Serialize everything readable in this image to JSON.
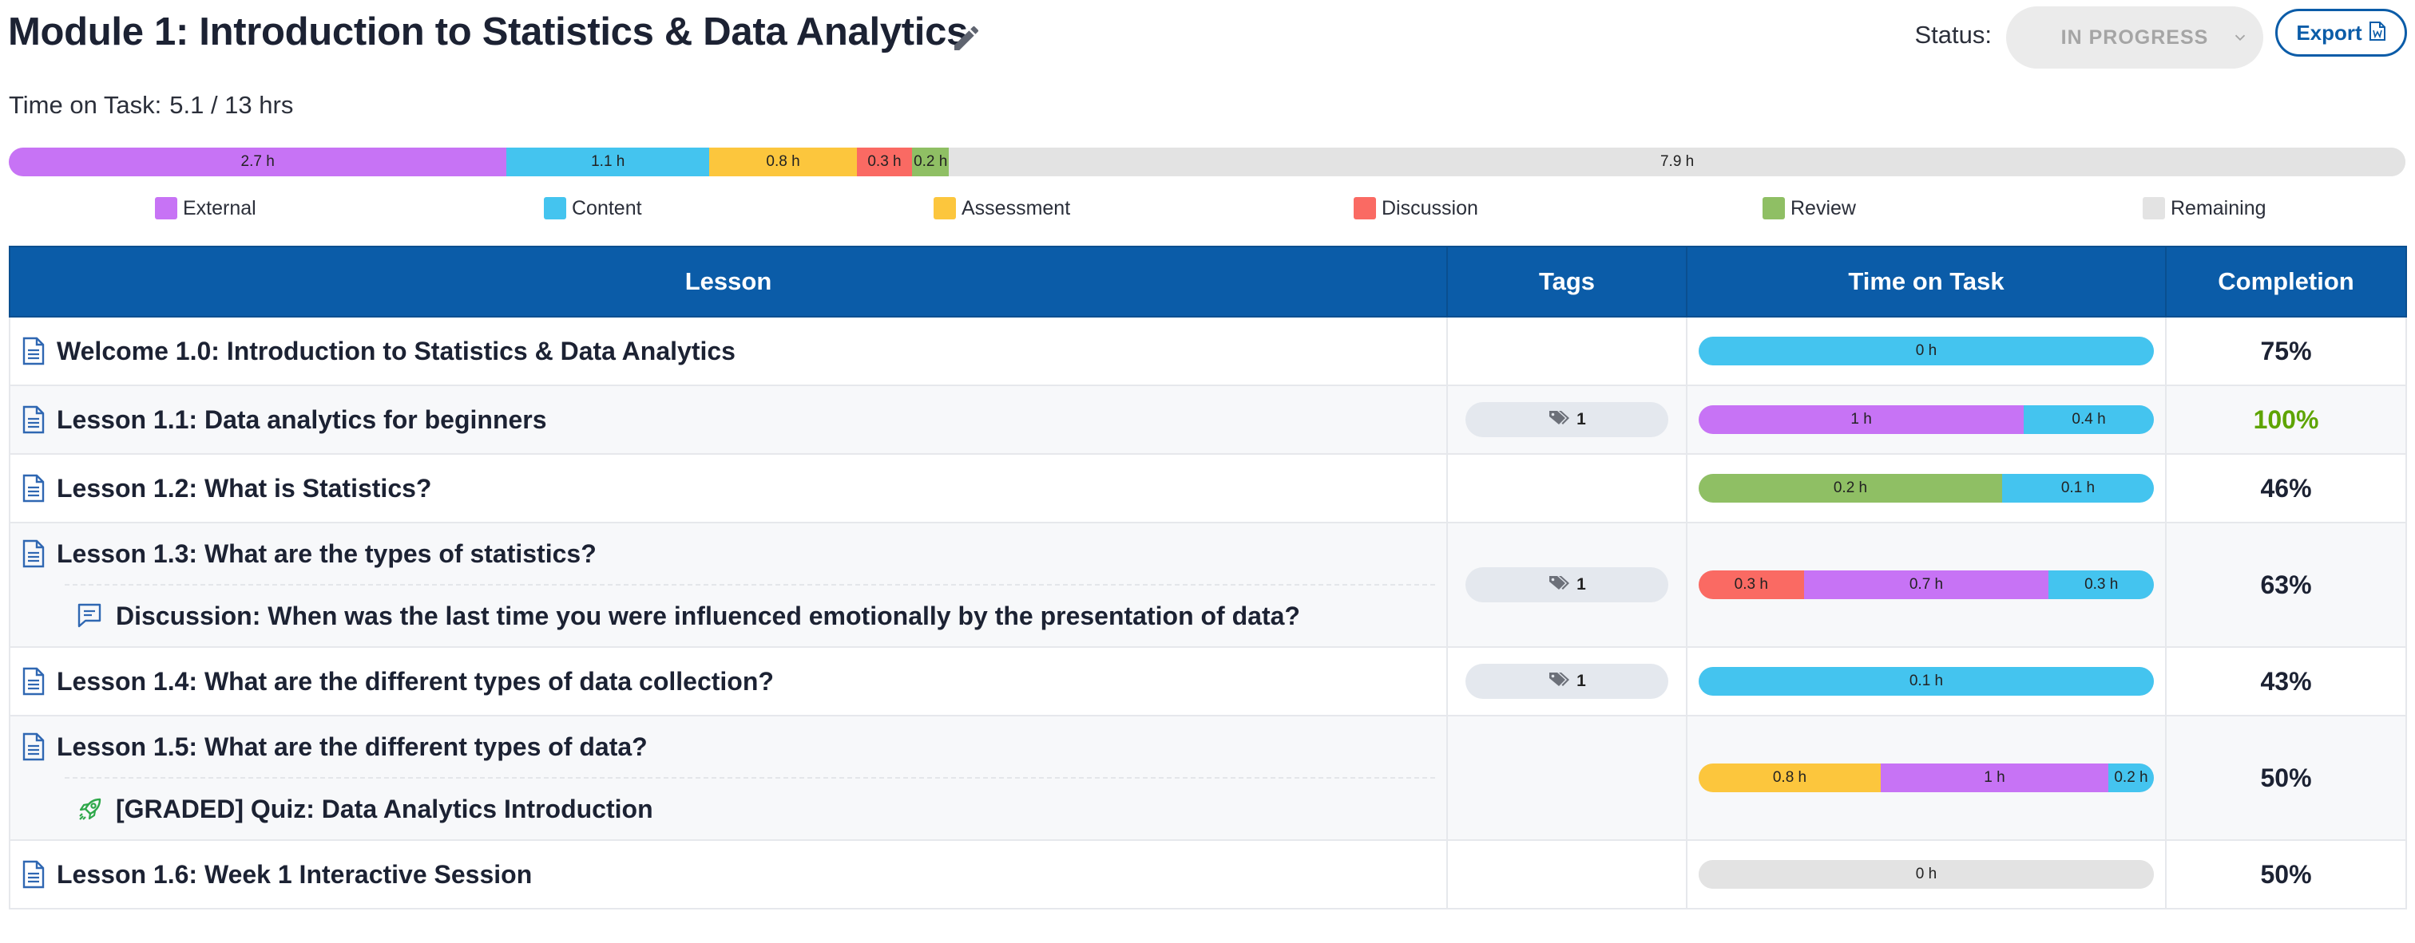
{
  "header": {
    "title": "Module 1: Introduction to Statistics & Data Analytics",
    "status_label": "Status:",
    "status_value": "IN PROGRESS",
    "export_label": "Export"
  },
  "time_on_task": {
    "label": "Time on Task:",
    "value": "5.1 / 13 hrs",
    "segments": [
      {
        "category": "External",
        "hours": 2.7,
        "label": "2.7 h"
      },
      {
        "category": "Content",
        "hours": 1.1,
        "label": "1.1 h"
      },
      {
        "category": "Assessment",
        "hours": 0.8,
        "label": "0.8 h"
      },
      {
        "category": "Discussion",
        "hours": 0.3,
        "label": "0.3 h"
      },
      {
        "category": "Review",
        "hours": 0.2,
        "label": "0.2 h"
      },
      {
        "category": "Remaining",
        "hours": 7.9,
        "label": "7.9 h"
      }
    ]
  },
  "legend": [
    {
      "label": "External",
      "color": "#c773f5"
    },
    {
      "label": "Content",
      "color": "#44c4ef"
    },
    {
      "label": "Assessment",
      "color": "#fcc63d"
    },
    {
      "label": "Discussion",
      "color": "#fa6a63"
    },
    {
      "label": "Review",
      "color": "#8fbf64"
    },
    {
      "label": "Remaining",
      "color": "#e3e3e3"
    }
  ],
  "colors": {
    "External": "#c773f5",
    "Content": "#44c4ef",
    "Assessment": "#fcc63d",
    "Discussion": "#fa6a63",
    "Review": "#8fbf64",
    "Remaining": "#e3e3e3",
    "header_bg": "#0b5ca8",
    "complete_text": "#5ea400"
  },
  "table": {
    "columns": [
      "Lesson",
      "Tags",
      "Time on Task",
      "Completion"
    ],
    "rows": [
      {
        "items": [
          {
            "icon": "document-icon",
            "title": "Welcome 1.0: Introduction to Statistics & Data Analytics"
          }
        ],
        "tags": null,
        "time": [
          {
            "category": "Content",
            "hours": 0,
            "label": "0 h"
          }
        ],
        "completion": "75%"
      },
      {
        "items": [
          {
            "icon": "document-icon",
            "title": "Lesson 1.1: Data analytics for beginners"
          }
        ],
        "tags": "1",
        "time": [
          {
            "category": "External",
            "hours": 1,
            "label": "1 h"
          },
          {
            "category": "Content",
            "hours": 0.4,
            "label": "0.4 h"
          }
        ],
        "completion": "100%"
      },
      {
        "items": [
          {
            "icon": "document-icon",
            "title": "Lesson 1.2: What is Statistics?"
          }
        ],
        "tags": null,
        "time": [
          {
            "category": "Review",
            "hours": 0.2,
            "label": "0.2 h"
          },
          {
            "category": "Content",
            "hours": 0.1,
            "label": "0.1 h"
          }
        ],
        "completion": "46%"
      },
      {
        "items": [
          {
            "icon": "document-icon",
            "title": "Lesson 1.3: What are the types of statistics?"
          },
          {
            "icon": "discussion-icon",
            "title": "Discussion: When was the last time you were influenced emotionally by the presentation of data?"
          }
        ],
        "tags": "1",
        "time": [
          {
            "category": "Discussion",
            "hours": 0.3,
            "label": "0.3 h"
          },
          {
            "category": "External",
            "hours": 0.7,
            "label": "0.7 h"
          },
          {
            "category": "Content",
            "hours": 0.3,
            "label": "0.3 h"
          }
        ],
        "completion": "63%"
      },
      {
        "items": [
          {
            "icon": "document-icon",
            "title": "Lesson 1.4: What are the different types of data collection?"
          }
        ],
        "tags": "1",
        "time": [
          {
            "category": "Content",
            "hours": 0.1,
            "label": "0.1 h"
          }
        ],
        "completion": "43%"
      },
      {
        "items": [
          {
            "icon": "document-icon",
            "title": "Lesson 1.5: What are the different types of data?"
          },
          {
            "icon": "rocket-icon",
            "title": "[GRADED] Quiz: Data Analytics Introduction"
          }
        ],
        "tags": null,
        "time": [
          {
            "category": "Assessment",
            "hours": 0.8,
            "label": "0.8 h"
          },
          {
            "category": "External",
            "hours": 1,
            "label": "1 h"
          },
          {
            "category": "Content",
            "hours": 0.2,
            "label": "0.2 h"
          }
        ],
        "completion": "50%"
      },
      {
        "items": [
          {
            "icon": "document-icon",
            "title": "Lesson 1.6: Week 1 Interactive Session"
          }
        ],
        "tags": null,
        "time": [
          {
            "category": "Remaining",
            "hours": 0,
            "label": "0 h"
          }
        ],
        "completion": "50%"
      }
    ]
  }
}
